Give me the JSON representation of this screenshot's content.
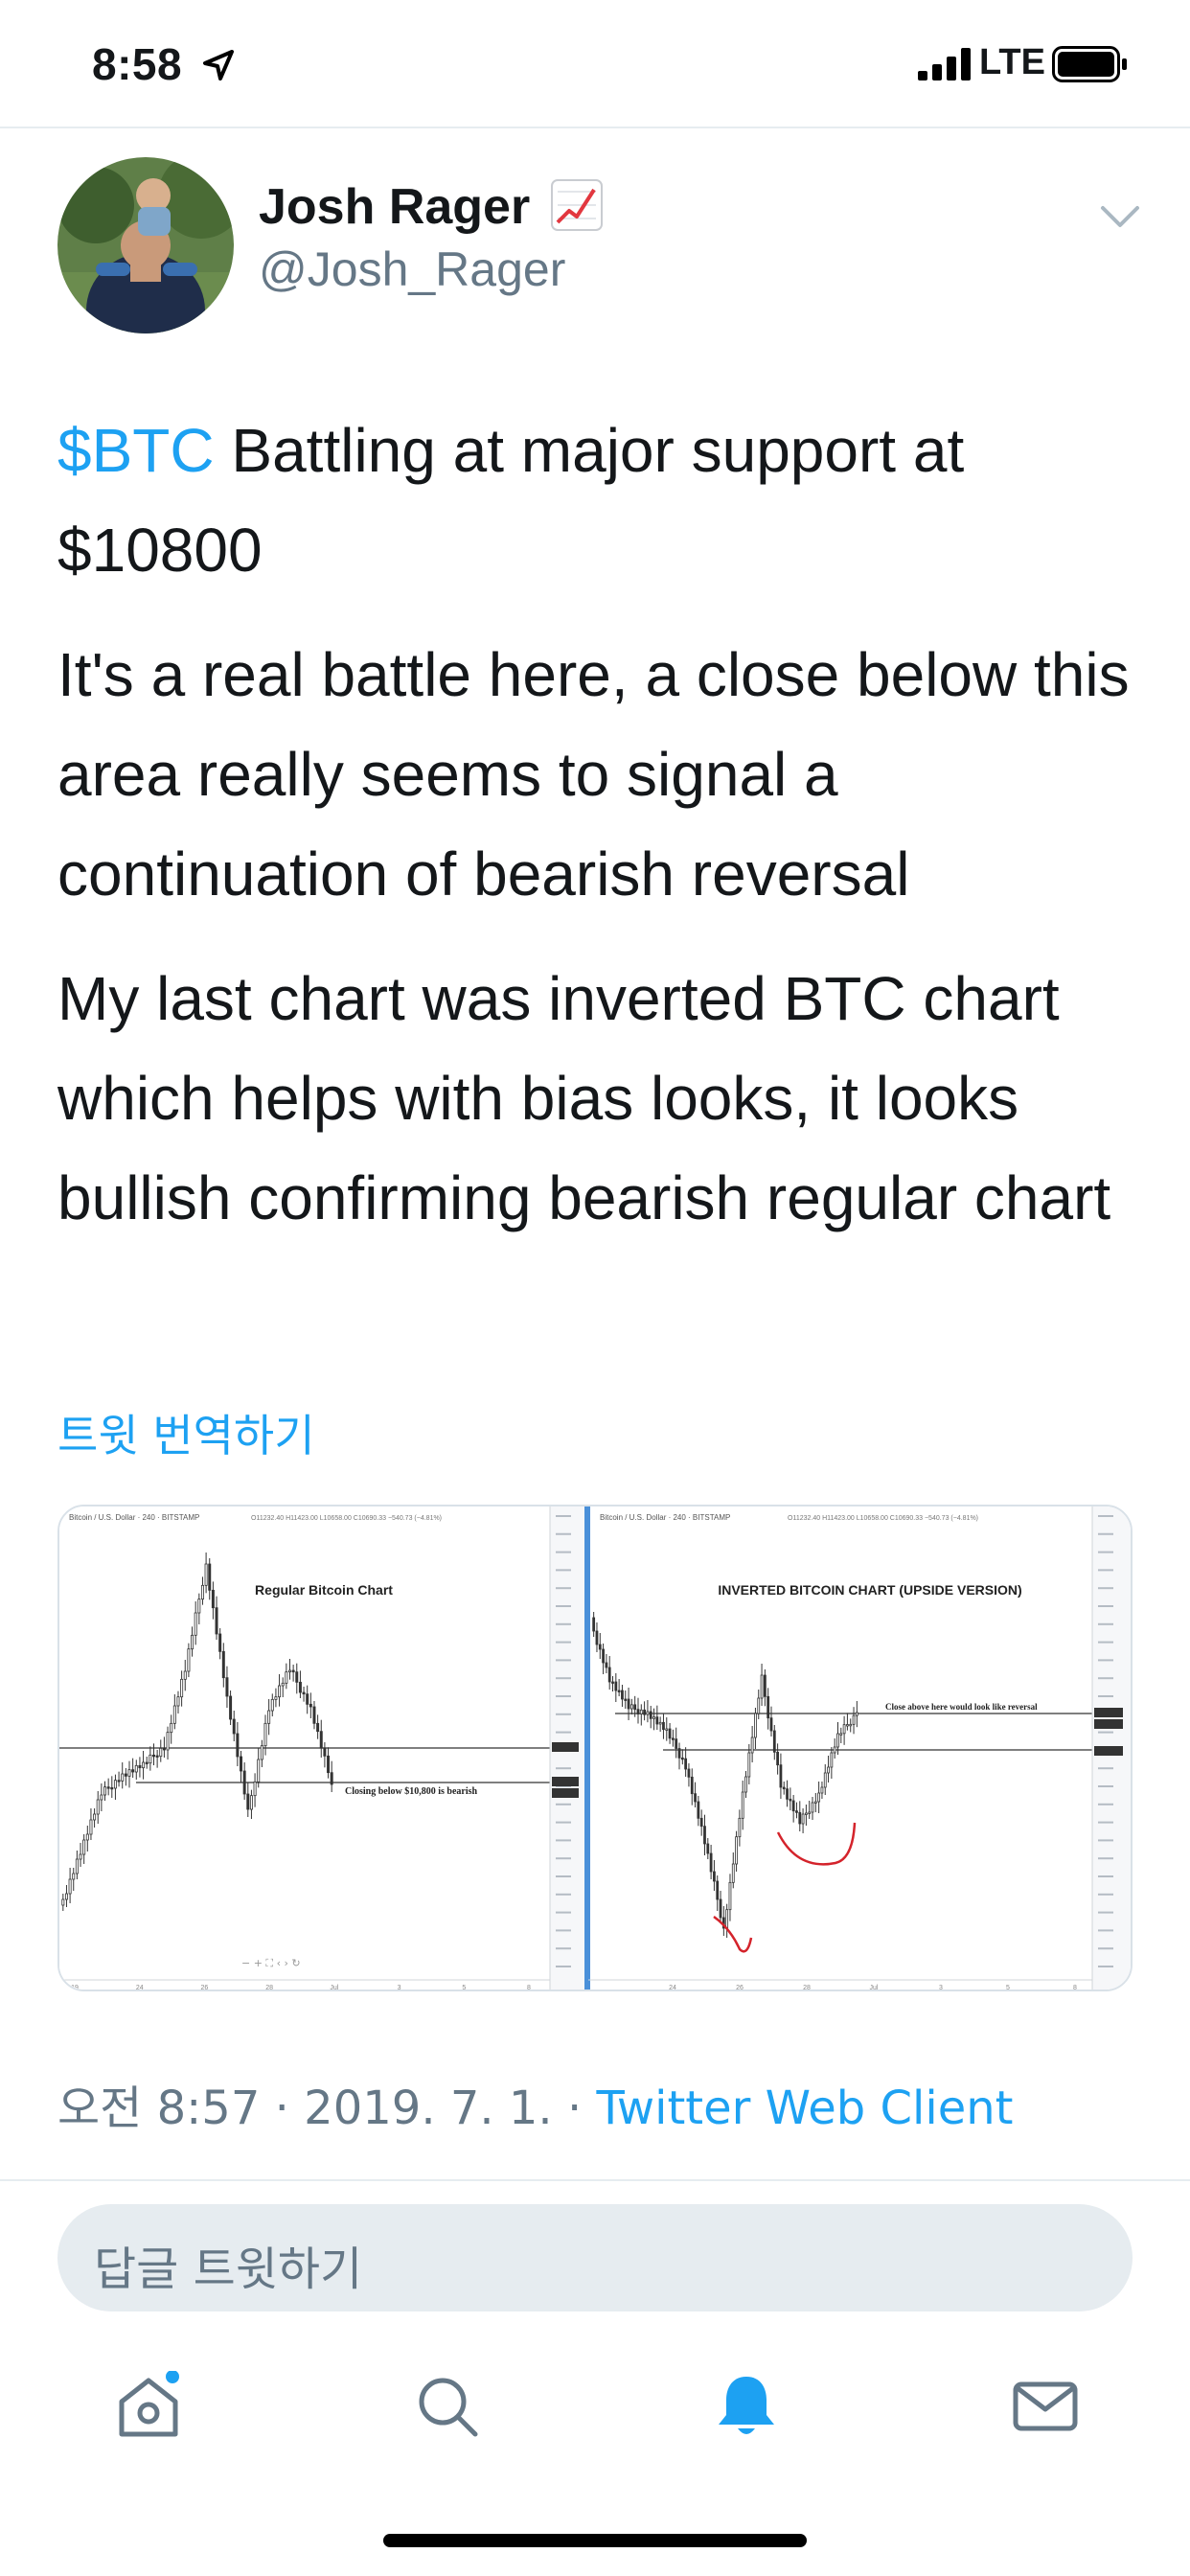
{
  "status_bar": {
    "time": "8:58",
    "network": "LTE",
    "icons": [
      "location-arrow-icon",
      "signal-bars-icon",
      "battery-icon"
    ]
  },
  "tweet": {
    "author": {
      "name": "Josh Rager",
      "name_emoji": "chart-increasing-icon",
      "handle": "@Josh_Rager"
    },
    "body": {
      "p1_cashtag": "$BTC",
      "p1_text": " Battling at major support at $10800",
      "p2": "It's a real battle here, a close below this area really seems to signal a continuation of bearish reversal",
      "p3": "My last chart was inverted BTC chart which helps with bias looks, it looks bullish confirming bearish regular chart"
    },
    "translate_label": "트윗 번역하기",
    "media": {
      "left": {
        "header": "Bitcoin / U.S. Dollar · 240 · BITSTAMP",
        "ohlc": "O11232.40  H11423.00  L10658.00  C10690.33  −540.73 (−4.81%)",
        "title": "Regular Bitcoin Chart",
        "annotation": "Closing below $10,800 is bearish",
        "x_ticks": [
          "19",
          "24",
          "26",
          "28",
          "Jul",
          "3",
          "5",
          "8"
        ]
      },
      "right": {
        "header": "Bitcoin / U.S. Dollar · 240 · BITSTAMP",
        "ohlc": "O11232.40  H11423.00  L10658.00  C10690.33  −540.73 (−4.81%)",
        "title": "INVERTED BITCOIN CHART (UPSIDE VERSION)",
        "annotation": "Close above here would look like reversal",
        "x_ticks": [
          "24",
          "26",
          "28",
          "Jul",
          "3",
          "5",
          "8"
        ]
      }
    },
    "meta": {
      "time": "오전 8:57",
      "sep1": " · ",
      "date": "2019. 7. 1.",
      "sep2": " · ",
      "source": "Twitter Web Client"
    }
  },
  "reply": {
    "placeholder": "답글 트윗하기"
  },
  "tab_bar": {
    "items": [
      "home-icon",
      "search-icon",
      "notifications-bell-icon",
      "messages-mail-icon"
    ],
    "active": "notifications-bell-icon",
    "accent": "#1da1f2"
  },
  "colors": {
    "accent": "#1da1f2",
    "secondary_text": "#657786",
    "divider": "#e6ecf0"
  }
}
